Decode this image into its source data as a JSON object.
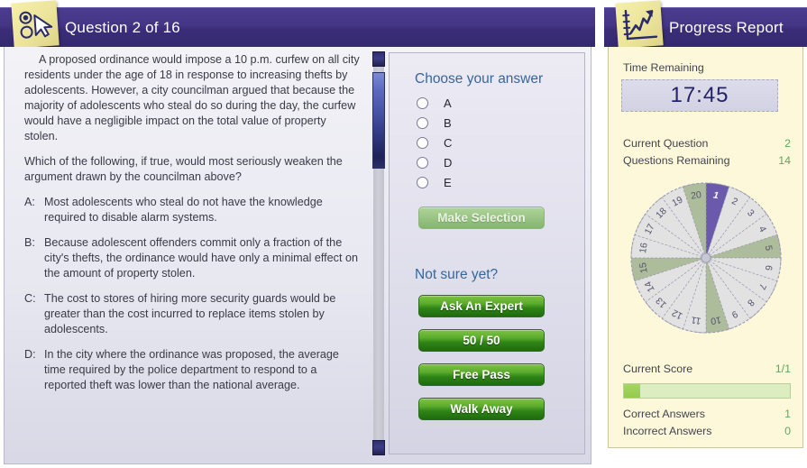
{
  "question_panel": {
    "title": "Question 2 of 16",
    "icon": "sticky-note-radio-cursor-icon",
    "passage": "A proposed ordinance would impose a 10 p.m. curfew on all city residents under the age of 18 in response to increasing thefts by adolescents. However, a city councilman argued that because the majority of adolescents who steal do so during the day, the curfew would have a negligible impact on the total value of property stolen.",
    "prompt": "Which of the following, if true, would most seriously weaken the argument drawn by the councilman above?",
    "choices": [
      {
        "letter": "A:",
        "text": "Most adolescents who steal do not have the knowledge required to disable alarm systems."
      },
      {
        "letter": "B:",
        "text": "Because adolescent offenders commit only a fraction of the city's thefts, the ordinance would have only a minimal effect on the amount of property stolen."
      },
      {
        "letter": "C:",
        "text": "The cost to stores of hiring more security guards would be greater than the cost incurred to replace items stolen by adolescents."
      },
      {
        "letter": "D:",
        "text": "In the city where the ordinance was proposed, the average time required by the police department to respond to a reported theft was lower than the national average."
      }
    ]
  },
  "answer_card": {
    "choose_heading": "Choose your answer",
    "options": [
      "A",
      "B",
      "C",
      "D",
      "E"
    ],
    "selected": "",
    "make_selection_label": "Make Selection",
    "not_sure_heading": "Not sure yet?",
    "lifelines": [
      "Ask An Expert",
      "50 / 50",
      "Free Pass",
      "Walk Away"
    ]
  },
  "progress_panel": {
    "title": "Progress Report",
    "icon": "sticky-note-line-chart-icon",
    "time_remaining_label": "Time Remaining",
    "time_remaining_value": "17:45",
    "stats": [
      {
        "label": "Current Question",
        "value": "2"
      },
      {
        "label": "Questions Remaining",
        "value": "14"
      }
    ],
    "current_score_label": "Current Score",
    "current_score_value": "1/1",
    "score_bar_percent": 10,
    "results": [
      {
        "label": "Correct Answers",
        "value": "1"
      },
      {
        "label": "Incorrect Answers",
        "value": "0"
      }
    ],
    "wheel": {
      "segments": 20,
      "current": 1,
      "labels": [
        1,
        2,
        3,
        4,
        5,
        6,
        7,
        8,
        9,
        10,
        11,
        12,
        13,
        14,
        15,
        16,
        17,
        18,
        19,
        20
      ],
      "highlighted": [
        5,
        10,
        15,
        20
      ],
      "colors": {
        "current": "#6b5aab",
        "highlight": "#adbc9a",
        "default": "#e2e2e2",
        "divider": "#9a9ab4"
      }
    }
  },
  "colors": {
    "header_purple": "#3d3080",
    "heading_blue": "#36669b",
    "green_button": "#3d8f1c",
    "timer_navy": "#23236b",
    "stat_green": "#5fa85f",
    "note_yellow": "#ece49b",
    "panel_cream": "#fcf8d9"
  }
}
